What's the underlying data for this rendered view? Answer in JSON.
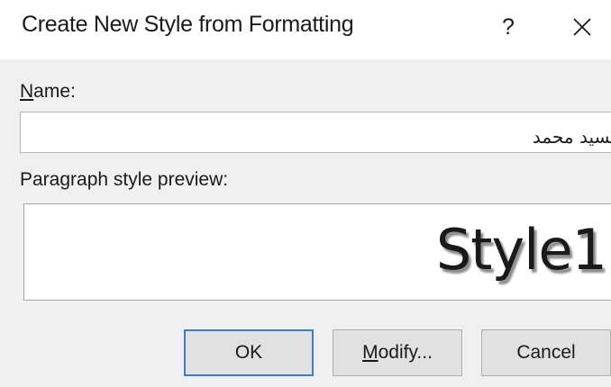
{
  "window": {
    "title": "Create New Style from Formatting",
    "help_label": "?",
    "close_icon": "close-icon"
  },
  "name_field": {
    "label_mnemonic": "N",
    "label_rest": "ame:",
    "value": "السيد محمد"
  },
  "preview": {
    "label": "Paragraph style preview:",
    "text": "Style1"
  },
  "buttons": {
    "ok": "OK",
    "modify_mnemonic": "M",
    "modify_rest": "odify...",
    "cancel": "Cancel"
  },
  "colors": {
    "default_button_border": "#3c7fc7",
    "dialog_background": "#f0f0f0"
  }
}
